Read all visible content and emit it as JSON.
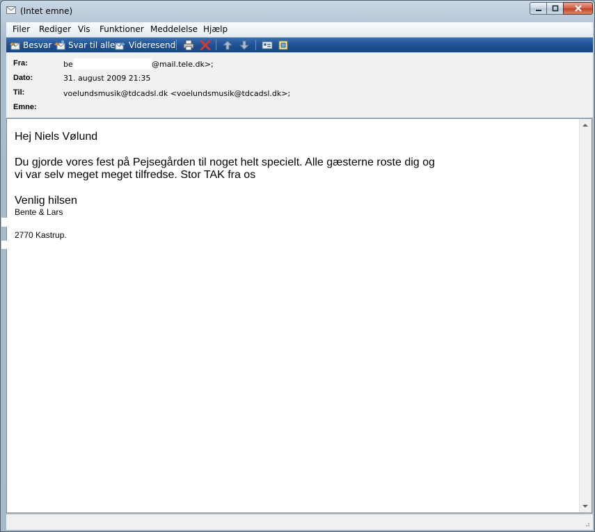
{
  "window": {
    "title": "(Intet emne)"
  },
  "menubar": {
    "items": [
      "Filer",
      "Rediger",
      "Vis",
      "Funktioner",
      "Meddelelse",
      "Hjælp"
    ]
  },
  "toolbar": {
    "reply": "Besvar",
    "reply_all": "Svar til alle",
    "forward": "Videresend"
  },
  "header": {
    "from_label": "Fra:",
    "from_value_prefix": "be",
    "from_value_suffix": "@mail.tele.dk>;",
    "date_label": "Dato:",
    "date_value": "31. august 2009 21:35",
    "to_label": "Til:",
    "to_value": "voelundsmusik@tdcadsl.dk <voelundsmusik@tdcadsl.dk>;",
    "subject_label": "Emne:",
    "subject_value": ""
  },
  "message": {
    "greeting": "Hej Niels Vølund",
    "para_line1": "Du gjorde vores fest på Pejsegården til noget helt specielt. Alle gæsterne roste dig og",
    "para_line2": "vi var selv meget meget tilfredse. Stor TAK fra os",
    "closing": "Venlig hilsen",
    "sig_name": "Bente & Lars",
    "sig_city": "2770 Kastrup."
  },
  "colors": {
    "toolbar": "#1d4f92",
    "close_button": "#c2401f"
  },
  "icons": [
    "envelope-icon",
    "reply-icon",
    "reply-all-icon",
    "forward-icon",
    "print-icon",
    "delete-icon",
    "previous-icon",
    "next-icon",
    "address-book-icon",
    "contacts-icon"
  ]
}
